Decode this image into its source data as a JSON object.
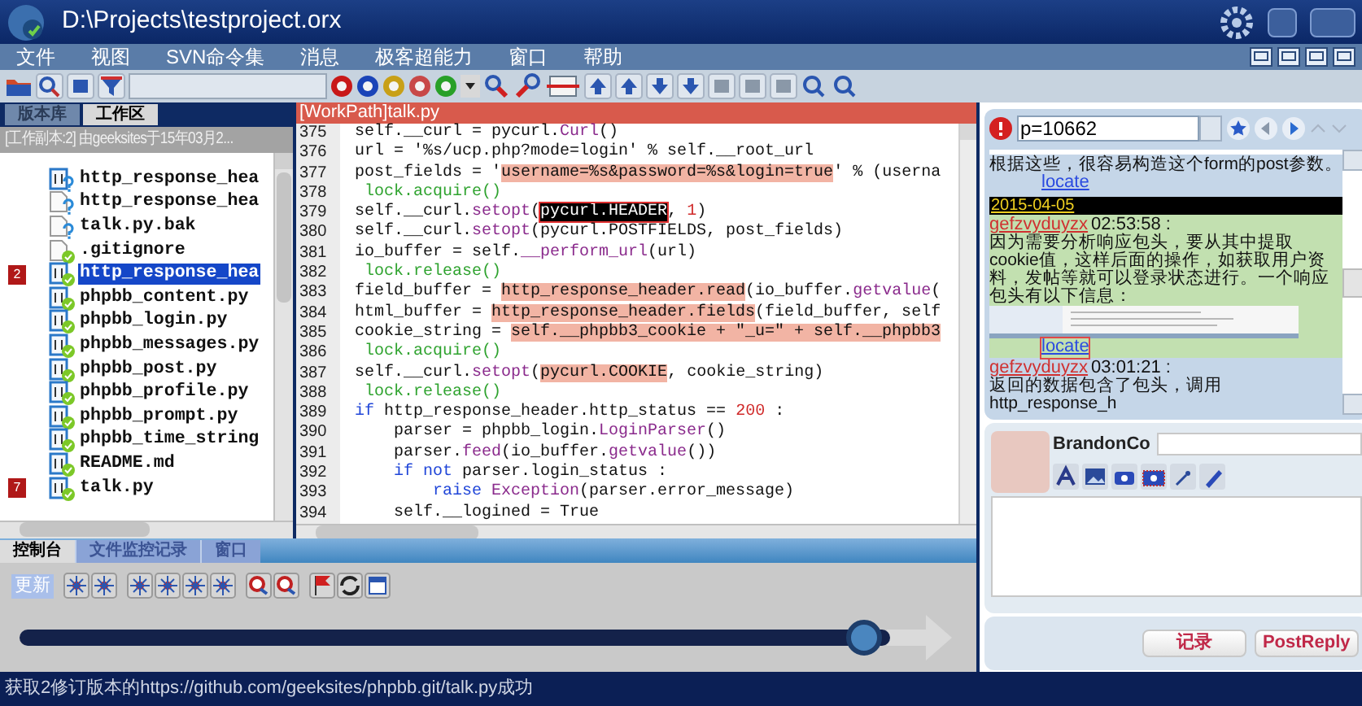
{
  "window": {
    "title": "D:\\Projects\\testproject.orx"
  },
  "menu": [
    "文件",
    "视图",
    "SVN命令集",
    "消息",
    "极客超能力",
    "窗口",
    "帮助"
  ],
  "left_panel": {
    "tabs": [
      {
        "label": "版本库",
        "selected": false
      },
      {
        "label": "工作区",
        "selected": true
      }
    ],
    "header": "[工作副本:2] 由geeksites于15年03月2...",
    "files": [
      {
        "name": "http_response_hea",
        "kind": "code",
        "unversioned": true,
        "selected": false
      },
      {
        "name": "http_response_hea",
        "kind": "file",
        "unversioned": true,
        "selected": false
      },
      {
        "name": "talk.py.bak",
        "kind": "file",
        "unversioned": true,
        "selected": false
      },
      {
        "name": ".gitignore",
        "kind": "file",
        "unversioned": false,
        "selected": false
      },
      {
        "name": "http_response_hea",
        "kind": "code",
        "unversioned": false,
        "selected": true,
        "badge": "2"
      },
      {
        "name": "phpbb_content.py",
        "kind": "code",
        "unversioned": false,
        "selected": false
      },
      {
        "name": "phpbb_login.py",
        "kind": "code",
        "unversioned": false,
        "selected": false
      },
      {
        "name": "phpbb_messages.py",
        "kind": "code",
        "unversioned": false,
        "selected": false
      },
      {
        "name": "phpbb_post.py",
        "kind": "code",
        "unversioned": false,
        "selected": false
      },
      {
        "name": "phpbb_profile.py",
        "kind": "code",
        "unversioned": false,
        "selected": false
      },
      {
        "name": "phpbb_prompt.py",
        "kind": "code",
        "unversioned": false,
        "selected": false
      },
      {
        "name": "phpbb_time_string",
        "kind": "code",
        "unversioned": false,
        "selected": false
      },
      {
        "name": "README.md",
        "kind": "code",
        "unversioned": false,
        "selected": false
      },
      {
        "name": "talk.py",
        "kind": "code",
        "unversioned": false,
        "selected": false,
        "badge": "7"
      }
    ]
  },
  "editor": {
    "tab": "[WorkPath]talk.py",
    "lines": [
      {
        "number": "375",
        "tokens": [
          {
            "text": "self.__curl = pycurl.",
            "kind": "plain"
          },
          {
            "text": "Curl",
            "kind": "func"
          },
          {
            "text": "()",
            "kind": "plain"
          }
        ]
      },
      {
        "number": "376",
        "tokens": [
          {
            "text": "url = '%s/ucp.php?mode=login' % self.__root_url",
            "kind": "plain"
          }
        ]
      },
      {
        "number": "377",
        "tokens": [
          {
            "text": "post_fields = '",
            "kind": "plain"
          },
          {
            "text": "username=%s&password=%s&login=true",
            "kind": "highlight"
          },
          {
            "text": "' % (userna",
            "kind": "plain"
          }
        ]
      },
      {
        "number": "378",
        "tokens": [
          {
            "text": " lock.acquire()",
            "kind": "lock"
          }
        ]
      },
      {
        "number": "379",
        "tokens": [
          {
            "text": "self.__curl.",
            "kind": "plain"
          },
          {
            "text": "setopt",
            "kind": "func"
          },
          {
            "text": "(",
            "kind": "plain"
          },
          {
            "text": "pycurl.HEADER",
            "kind": "selected",
            "framed": true
          },
          {
            "text": ", ",
            "kind": "plain"
          },
          {
            "text": "1",
            "kind": "number"
          },
          {
            "text": ")",
            "kind": "plain"
          }
        ]
      },
      {
        "number": "380",
        "tokens": [
          {
            "text": "self.__curl.",
            "kind": "plain"
          },
          {
            "text": "setopt",
            "kind": "func"
          },
          {
            "text": "(pycurl.POSTFIELDS, post_fields)",
            "kind": "plain"
          }
        ]
      },
      {
        "number": "381",
        "tokens": [
          {
            "text": "io_buffer = self.",
            "kind": "plain"
          },
          {
            "text": "__perform_url",
            "kind": "func"
          },
          {
            "text": "(url)",
            "kind": "plain"
          }
        ]
      },
      {
        "number": "382",
        "tokens": [
          {
            "text": " lock.release()",
            "kind": "lock"
          }
        ]
      },
      {
        "number": "383",
        "tokens": [
          {
            "text": "field_buffer = ",
            "kind": "plain"
          },
          {
            "text": "http_response_header.read",
            "kind": "highlight"
          },
          {
            "text": "(io_buffer.",
            "kind": "plain"
          },
          {
            "text": "getvalue",
            "kind": "func"
          },
          {
            "text": "(",
            "kind": "plain"
          }
        ]
      },
      {
        "number": "384",
        "tokens": [
          {
            "text": "html_buffer = ",
            "kind": "plain"
          },
          {
            "text": "http_response_header.fields",
            "kind": "highlight"
          },
          {
            "text": "(field_buffer, self",
            "kind": "plain"
          }
        ]
      },
      {
        "number": "385",
        "tokens": [
          {
            "text": "cookie_string = ",
            "kind": "plain"
          },
          {
            "text": "self.__phpbb3_cookie + \"_u=\" + self.__phpbb3",
            "kind": "highlight"
          }
        ]
      },
      {
        "number": "386",
        "tokens": [
          {
            "text": " lock.acquire()",
            "kind": "lock"
          }
        ]
      },
      {
        "number": "387",
        "tokens": [
          {
            "text": "self.__curl.",
            "kind": "plain"
          },
          {
            "text": "setopt",
            "kind": "func"
          },
          {
            "text": "(",
            "kind": "plain"
          },
          {
            "text": "pycurl.COOKIE",
            "kind": "highlight"
          },
          {
            "text": ", cookie_string)",
            "kind": "plain"
          }
        ]
      },
      {
        "number": "388",
        "tokens": [
          {
            "text": " lock.release()",
            "kind": "lock"
          }
        ]
      },
      {
        "number": "389",
        "tokens": [
          {
            "text": "if",
            "kind": "keyword"
          },
          {
            "text": " http_response_header.http_status == ",
            "kind": "plain"
          },
          {
            "text": "200",
            "kind": "number"
          },
          {
            "text": " :",
            "kind": "plain"
          }
        ]
      },
      {
        "number": "390",
        "tokens": [
          {
            "text": "    parser = phpbb_login.",
            "kind": "plain"
          },
          {
            "text": "LoginParser",
            "kind": "func"
          },
          {
            "text": "()",
            "kind": "plain"
          }
        ]
      },
      {
        "number": "391",
        "tokens": [
          {
            "text": "    parser.",
            "kind": "plain"
          },
          {
            "text": "feed",
            "kind": "func"
          },
          {
            "text": "(io_buffer.",
            "kind": "plain"
          },
          {
            "text": "getvalue",
            "kind": "func"
          },
          {
            "text": "())",
            "kind": "plain"
          }
        ]
      },
      {
        "number": "392",
        "tokens": [
          {
            "text": "    if not",
            "kind": "keyword"
          },
          {
            "text": " parser.login_status :",
            "kind": "plain"
          }
        ]
      },
      {
        "number": "393",
        "tokens": [
          {
            "text": "        raise",
            "kind": "keyword"
          },
          {
            "text": " Exception",
            "kind": "func"
          },
          {
            "text": "(parser.error_message)",
            "kind": "plain"
          }
        ]
      },
      {
        "number": "394",
        "tokens": [
          {
            "text": "    self.__logined = True",
            "kind": "plain"
          }
        ]
      }
    ]
  },
  "chat": {
    "url": "p=10662",
    "entries": [
      {
        "kind": "image"
      },
      {
        "kind": "text",
        "text": "根据这些，很容易构造这个form的post参数。"
      },
      {
        "kind": "link",
        "text": "locate"
      },
      {
        "kind": "date",
        "text": "2015-04-05"
      },
      {
        "kind": "post",
        "highlighted": true,
        "author": "gefzvyduyzx",
        "time": "02:53:58 :",
        "body": "因为需要分析响应包头，要从其中提取cookie值，这样后面的操作，如获取用户资料，发帖等就可以登录状态进行。一个响应包头有以下信息：",
        "image": true,
        "link": "locate",
        "link_framed": true
      },
      {
        "kind": "post",
        "highlighted": false,
        "author": "gefzvyduyzx",
        "time": "03:01:21 :",
        "body": "返回的数据包含了包头，调用http_response_h"
      }
    ]
  },
  "compose": {
    "user": "BrandonCo",
    "buttons": [
      "记录",
      "PostReply"
    ]
  },
  "console": {
    "tabs": [
      {
        "label": "控制台",
        "selected": true
      },
      {
        "label": "文件监控记录",
        "selected": false
      },
      {
        "label": "窗口",
        "selected": false
      }
    ],
    "update_button": "更新",
    "slider": {
      "level": 0.97
    }
  },
  "status_bar": "获取2修订版本的https://github.com/geeksites/phpbb.git/talk.py成功"
}
